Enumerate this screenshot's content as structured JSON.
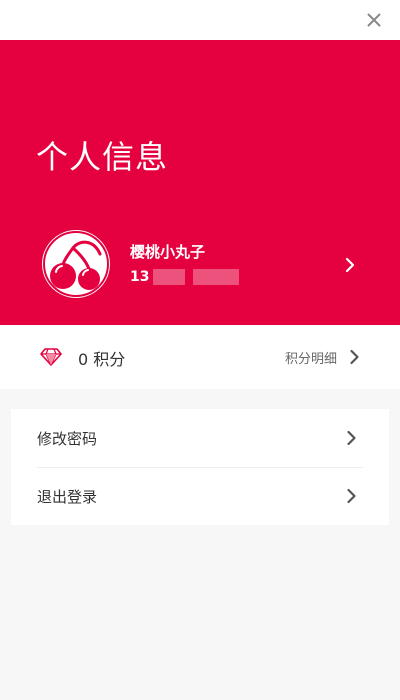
{
  "window": {
    "close_icon": "close-icon"
  },
  "hero": {
    "title": "个人信息",
    "background_color": "#e5003f"
  },
  "profile": {
    "username": "樱桃小丸子",
    "phone_prefix": "13",
    "avatar_icon": "cherry-avatar-icon"
  },
  "points": {
    "value_text": "0 积分",
    "detail_link": "积分明细",
    "icon": "gem-icon"
  },
  "menu": {
    "items": [
      {
        "label": "修改密码"
      },
      {
        "label": "退出登录"
      }
    ]
  }
}
